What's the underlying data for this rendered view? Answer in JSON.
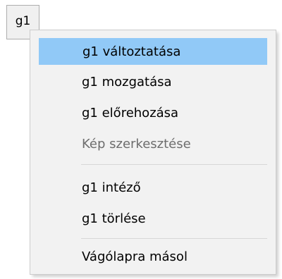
{
  "button": {
    "label": "g1"
  },
  "menu": {
    "items": [
      {
        "label": "g1 változtatása",
        "state": "highlighted"
      },
      {
        "label": "g1 mozgatása",
        "state": "normal"
      },
      {
        "label": "g1 előrehozása",
        "state": "normal"
      },
      {
        "label": "Kép szerkesztése",
        "state": "disabled"
      },
      {
        "label": "g1 intéző",
        "state": "normal"
      },
      {
        "label": "g1 törlése",
        "state": "normal"
      },
      {
        "label": "Vágólapra másol",
        "state": "normal"
      }
    ]
  },
  "colors": {
    "highlight": "#91c9f7",
    "menu_background": "#f2f2f2",
    "disabled_text": "#6d6d6d"
  }
}
